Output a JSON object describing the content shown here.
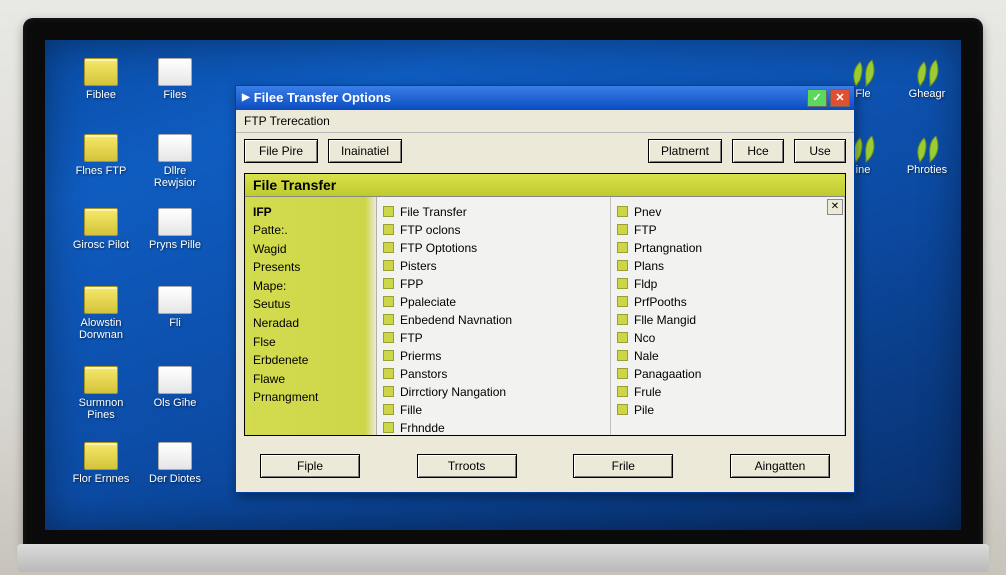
{
  "window": {
    "title": "Filee Transfer Options",
    "subtitle": "FTP Trerecation"
  },
  "toolbar": {
    "btn1": "File  Pire",
    "btn2": "Inainatiel",
    "btn3": "Platnernt",
    "btn4": "Hce",
    "btn5": "Use"
  },
  "section_header": "File Transfer",
  "sidebar": {
    "items": [
      "IFP",
      "Patte:.",
      "Wagid",
      "Presents",
      "Mape:",
      "Seutus",
      "Neradad",
      "Flse",
      "Erbdenete",
      "Flawe",
      "Prnangment"
    ]
  },
  "columns": {
    "c1": [
      "File Transfer",
      "FTP oclons",
      "FTP Optotions",
      "Pisters",
      "FPP",
      "Ppaleciate",
      "Enbedend Navnation",
      "FTP",
      "Prierms",
      "Panstors",
      "Dirrctiory Nangation",
      "Fille",
      "Frhndde"
    ],
    "c2": [
      "Pnev",
      "FTP",
      "Prtangnation",
      "Plans",
      "Fldp",
      "PrfPooths",
      "Flle Mangid",
      "Nco",
      "Nale",
      "Panagaation",
      "Frule",
      "Pile"
    ]
  },
  "footer": {
    "b1": "Fiple",
    "b2": "Trroots",
    "b3": "Frile",
    "b4": "Aingatten"
  },
  "desktop": {
    "col1": [
      {
        "label": "Fiblee",
        "type": "folder-yellow"
      },
      {
        "label": "Flnes FTP",
        "type": "folder-yellow"
      },
      {
        "label": "Girosc Pilot",
        "type": "folder-yellow"
      },
      {
        "label": "Alowstin Dorwnan",
        "type": "folder-yellow"
      },
      {
        "label": "Surmnon Pines",
        "type": "folder-yellow"
      },
      {
        "label": "Flor Ernnes",
        "type": "folder-yellow"
      }
    ],
    "col2": [
      {
        "label": "Files",
        "type": "folder-white"
      },
      {
        "label": "Dllre Rewjsior",
        "type": "folder-white"
      },
      {
        "label": "Pryns Pille",
        "type": "folder-white"
      },
      {
        "label": "Fli",
        "type": "folder-white"
      },
      {
        "label": "Ols Gihe",
        "type": "folder-white"
      },
      {
        "label": "Der Diotes",
        "type": "folder-white"
      }
    ],
    "col3": [
      {
        "label": "Fle",
        "type": "leaf"
      },
      {
        "label": "ine",
        "type": "leaf"
      }
    ],
    "col4": [
      {
        "label": "Gheagr",
        "type": "leaf"
      },
      {
        "label": "Phroties",
        "type": "leaf"
      }
    ]
  }
}
